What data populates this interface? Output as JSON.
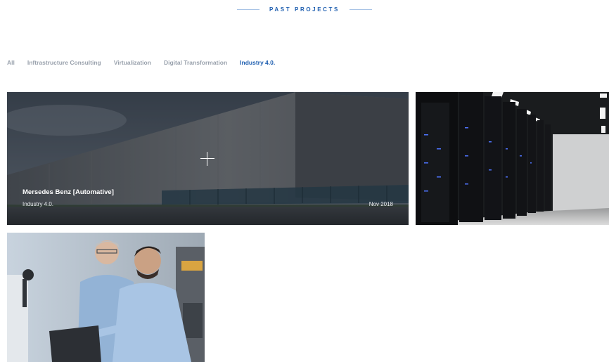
{
  "section": {
    "title": "PAST PROJECTS"
  },
  "filters": {
    "items": [
      {
        "label": "All"
      },
      {
        "label": "Inftrastructure Consulting"
      },
      {
        "label": "Virtualization"
      },
      {
        "label": "Digital Transformation"
      },
      {
        "label": "Industry 4.0."
      }
    ],
    "active": "Industry 4.0."
  },
  "projects": [
    {
      "title": "Mersedes Benz [Automative]",
      "category": "Industry 4.0.",
      "date": "Nov 2018"
    }
  ],
  "colors": {
    "accent": "#1f5fb0",
    "filter_inactive": "#9aa2ad",
    "heading_line": "#a9c4e6"
  },
  "icons": {
    "card_hover": "plus-icon"
  }
}
